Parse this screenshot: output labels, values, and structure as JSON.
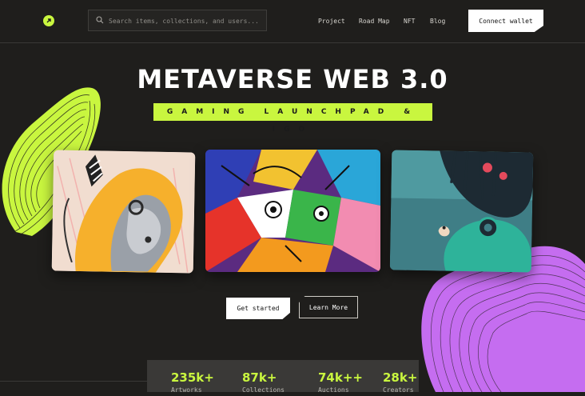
{
  "header": {
    "logo": "logo-icon",
    "search": {
      "placeholder": "Search items, collections, and users..."
    },
    "nav": [
      {
        "label": "Project"
      },
      {
        "label": "Road Map"
      },
      {
        "label": "NFT"
      },
      {
        "label": "Blog"
      }
    ],
    "connect_label": "Connect wallet"
  },
  "hero": {
    "title": "METAVERSE WEB 3.0",
    "subtitle": "GAMING LAUNCHPAD & IGO"
  },
  "cards": [
    {
      "art": "portrait-artwork-1"
    },
    {
      "art": "abstract-cubist-artwork"
    },
    {
      "art": "green-astronaut-artwork"
    }
  ],
  "actions": {
    "get_started": "Get started",
    "learn_more": "Learn More"
  },
  "stats": [
    {
      "value": "235k+",
      "label": "Artworks"
    },
    {
      "value": "87k+",
      "label": "Collections"
    },
    {
      "value": "74k++",
      "label": "Auctions"
    },
    {
      "value": "28k+",
      "label": "Creators"
    }
  ],
  "colors": {
    "accent": "#c9f63f",
    "background": "#1f1e1c",
    "purple": "#c56df0"
  }
}
